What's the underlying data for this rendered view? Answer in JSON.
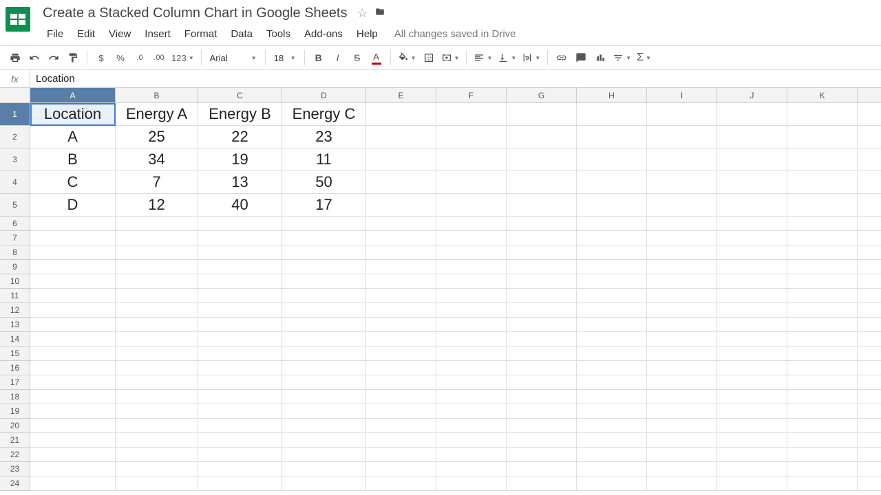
{
  "doc": {
    "title": "Create a Stacked Column Chart in Google Sheets"
  },
  "menubar": [
    "File",
    "Edit",
    "View",
    "Insert",
    "Format",
    "Data",
    "Tools",
    "Add-ons",
    "Help"
  ],
  "save_status": "All changes saved in Drive",
  "toolbar": {
    "format_123": "123",
    "font_name": "Arial",
    "font_size": "18",
    "currency": "$",
    "percent": "%"
  },
  "formula_bar": {
    "fx": "fx",
    "value": "Location"
  },
  "grid": {
    "columns": [
      "A",
      "B",
      "C",
      "D",
      "E",
      "F",
      "G",
      "H",
      "I",
      "J",
      "K"
    ],
    "active_cell": "A1",
    "headers": [
      "Location",
      "Energy A",
      "Energy B",
      "Energy C"
    ],
    "data": [
      [
        "A",
        "25",
        "22",
        "23"
      ],
      [
        "B",
        "34",
        "19",
        "11"
      ],
      [
        "C",
        "7",
        "13",
        "50"
      ],
      [
        "D",
        "12",
        "40",
        "17"
      ]
    ],
    "row_count_visible": 24
  },
  "chart_data": {
    "type": "bar",
    "stacked": true,
    "categories": [
      "A",
      "B",
      "C",
      "D"
    ],
    "series": [
      {
        "name": "Energy A",
        "values": [
          25,
          34,
          7,
          12
        ]
      },
      {
        "name": "Energy B",
        "values": [
          22,
          19,
          13,
          40
        ]
      },
      {
        "name": "Energy C",
        "values": [
          23,
          11,
          50,
          17
        ]
      }
    ],
    "title": "Create a Stacked Column Chart in Google Sheets",
    "xlabel": "Location",
    "ylabel": ""
  }
}
